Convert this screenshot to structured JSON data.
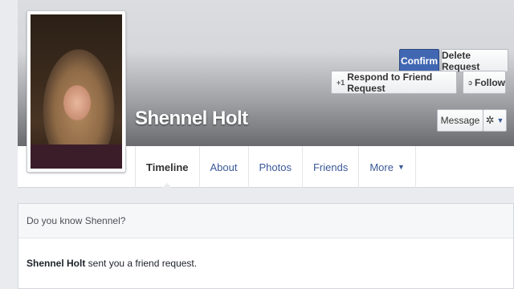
{
  "profile": {
    "name": "Shennel Holt"
  },
  "actions": {
    "respond_label": "Respond to Friend Request",
    "follow_label": "Follow",
    "message_label": "Message"
  },
  "tabs": [
    {
      "label": "Timeline"
    },
    {
      "label": "About"
    },
    {
      "label": "Photos"
    },
    {
      "label": "Friends"
    },
    {
      "label": "More"
    }
  ],
  "request": {
    "header": "Do you know Shennel?",
    "sender": "Shennel Holt",
    "message_suffix": " sent you a friend request.",
    "confirm_label": "Confirm",
    "delete_label": "Delete Request"
  },
  "icons": {
    "respond": "person-add-icon",
    "follow": "rss-icon",
    "settings": "gear-icon",
    "dropdown": "chevron-down-icon"
  },
  "colors": {
    "brand_blue": "#3b5998",
    "confirm_blue": "#4267b2",
    "background": "#e9ebee"
  }
}
